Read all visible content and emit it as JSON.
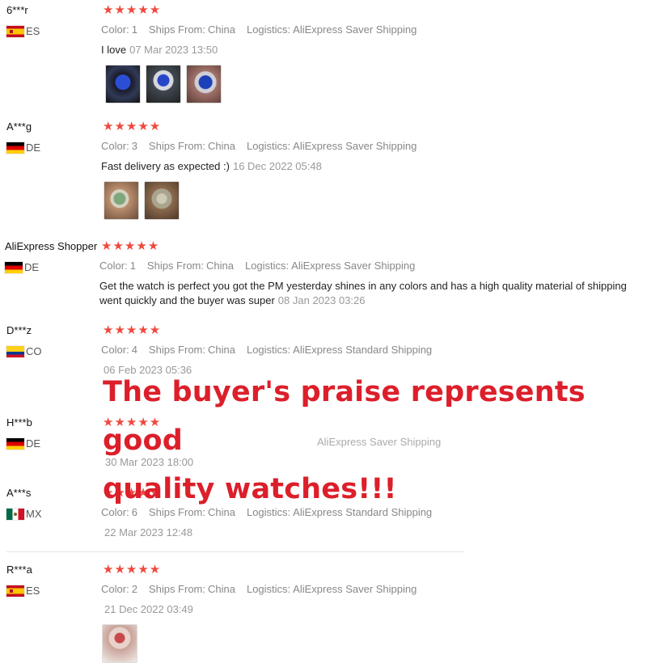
{
  "reviews": [
    {
      "user": "6***r",
      "country": "ES",
      "flag": "es",
      "stars": "★★★★★",
      "color_label": "Color:",
      "color_value": "1",
      "ships_label": "Ships From:",
      "ships_value": "China",
      "logistics_label": "Logistics:",
      "logistics_value": "AliExpress Saver Shipping",
      "text": "I love",
      "date": "07 Mar 2023 13:50",
      "photos": [
        "watch-photo",
        "watch-photo",
        "watch-photo"
      ]
    },
    {
      "user": "A***g",
      "country": "DE",
      "flag": "de",
      "stars": "★★★★★",
      "color_label": "Color:",
      "color_value": "3",
      "ships_label": "Ships From:",
      "ships_value": "China",
      "logistics_label": "Logistics:",
      "logistics_value": "AliExpress Saver Shipping",
      "text": "Fast delivery as expected :)",
      "date": "16 Dec 2022 05:48",
      "photos": [
        "watch-photo",
        "watch-photo"
      ]
    },
    {
      "user": "AliExpress Shopper",
      "country": "DE",
      "flag": "de",
      "stars": "★★★★★",
      "color_label": "Color:",
      "color_value": "1",
      "ships_label": "Ships From:",
      "ships_value": "China",
      "logistics_label": "Logistics:",
      "logistics_value": "AliExpress Saver Shipping",
      "text": "Get the watch is perfect you got the PM yesterday shines in any colors and has a high quality material of shipping went quickly and the buyer was super",
      "date": "08 Jan 2023 03:26"
    },
    {
      "user": "D***z",
      "country": "CO",
      "flag": "co",
      "stars": "★★★★★",
      "color_label": "Color:",
      "color_value": "4",
      "ships_label": "Ships From:",
      "ships_value": "China",
      "logistics_label": "Logistics:",
      "logistics_value": "AliExpress Standard Shipping",
      "date": "06 Feb 2023 05:36"
    },
    {
      "user": "H***b",
      "country": "DE",
      "flag": "de",
      "stars": "★★★★★",
      "logistics_value": "AliExpress Saver Shipping",
      "date": "30 Mar 2023 18:00"
    },
    {
      "user": "A***s",
      "country": "MX",
      "flag": "mx",
      "stars": "★★★★★",
      "color_label": "Color:",
      "color_value": "6",
      "ships_label": "Ships From:",
      "ships_value": "China",
      "logistics_label": "Logistics:",
      "logistics_value": "AliExpress Standard Shipping",
      "date": "22 Mar 2023 12:48"
    },
    {
      "user": "R***a",
      "country": "ES",
      "flag": "es",
      "stars": "★★★★★",
      "color_label": "Color:",
      "color_value": "2",
      "ships_label": "Ships From:",
      "ships_value": "China",
      "logistics_label": "Logistics:",
      "logistics_value": "AliExpress Saver Shipping",
      "date": "21 Dec 2022 03:49",
      "photos": [
        "watch-photo"
      ]
    }
  ],
  "overlay": {
    "line1": "The buyer's praise represents good",
    "line2": "quality watches!!!",
    "color": "#dc1f2a"
  },
  "colors": {
    "star": "#f0493e",
    "muted": "#888888"
  }
}
